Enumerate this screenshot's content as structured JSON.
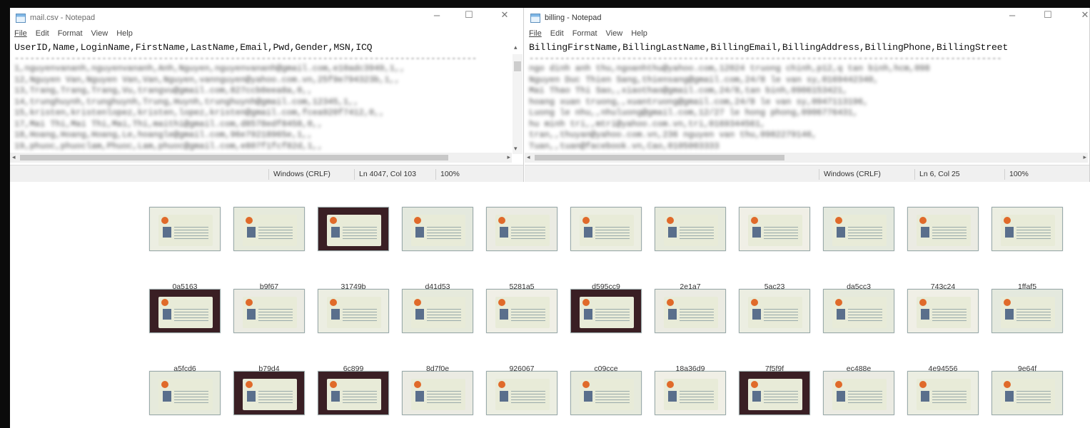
{
  "window1": {
    "title": "mail.csv - Notepad",
    "menu": [
      "File",
      "Edit",
      "Format",
      "View",
      "Help"
    ],
    "header_line": "UserID,Name,LoginName,FirstName,LastName,Email,Pwd,Gender,MSN,ICQ",
    "status": {
      "line_ending": "Windows (CRLF)",
      "position": "Ln 4047, Col 103",
      "zoom": "100%"
    }
  },
  "window2": {
    "title": "billing - Notepad",
    "menu": [
      "File",
      "Edit",
      "Format",
      "View",
      "Help"
    ],
    "header_line": "BillingFirstName,BillingLastName,BillingEmail,BillingAddress,BillingPhone,BillingStreet",
    "status": {
      "line_ending": "Windows (CRLF)",
      "position": "Ln 6, Col 25",
      "zoom": "100%"
    }
  },
  "window_controls": {
    "minimize": "–",
    "maximize": "☐",
    "close": "✕"
  },
  "thumbnails": [
    [
      "0a5163",
      "b9f67",
      "31749b",
      "d41d53",
      "5281a5",
      "d595cc9",
      "2e1a7",
      "5ac23",
      "da5cc3",
      "743c24",
      "1ffaf5"
    ],
    [
      "a5fcd6",
      "b79d4",
      "6c899",
      "8d7f0e",
      "926067",
      "c09cce",
      "18a36d9",
      "7f5f9f",
      "ec488e",
      "4e94556",
      "9e64f"
    ],
    [
      "",
      "",
      "",
      "",
      "",
      "",
      "",
      "",
      "",
      "",
      ""
    ]
  ],
  "colors": {
    "border": "#0b0b0b",
    "statusbar": "#f0f0f0",
    "card": "#e8ebd8"
  }
}
